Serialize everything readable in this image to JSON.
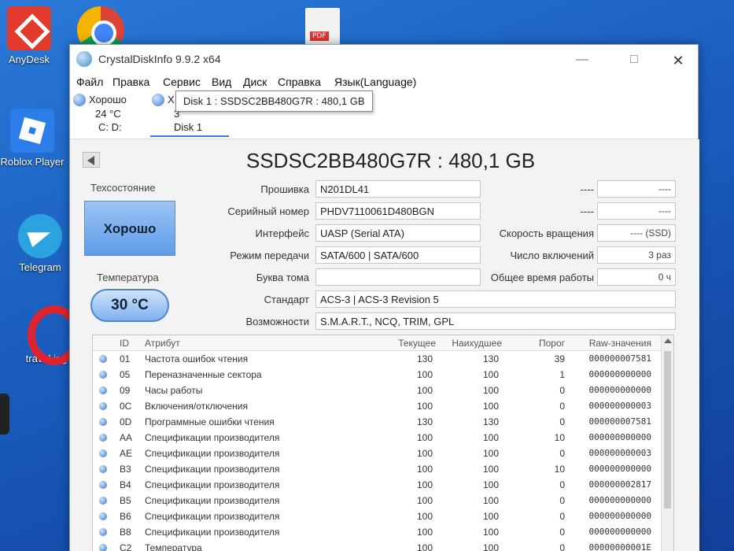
{
  "desktop": {
    "icons": [
      {
        "label": "AnyDesk"
      },
      {
        "label": "Roblox Player"
      },
      {
        "label": "Telegram"
      },
      {
        "label": "travel.jpg"
      }
    ],
    "pdf_badge": "PDF"
  },
  "window": {
    "title": "CrystalDiskInfo 9.9.2 x64",
    "controls": {
      "minimize": "—",
      "maximize": "□",
      "close": "✕"
    }
  },
  "menu": [
    "Файл",
    "Правка",
    "Сервис",
    "Вид",
    "Диск",
    "Справка",
    "Язык(Language)"
  ],
  "disks": [
    {
      "status": "Хорошо",
      "temp": "24 °C",
      "name": "C: D:"
    },
    {
      "status": "Х",
      "temp": "3",
      "name": "Disk 1"
    }
  ],
  "tooltip": "Disk 1 : SSDSC2BB480G7R : 480,1 GB",
  "model_title": "SSDSC2BB480G7R : 480,1 GB",
  "health": {
    "label": "Техсостояние",
    "value": "Хорошо"
  },
  "temperature": {
    "label": "Температура",
    "value": "30 °C"
  },
  "fields": {
    "firmware": {
      "label": "Прошивка",
      "value": "N201DL41"
    },
    "serial": {
      "label": "Серийный номер",
      "value": "PHDV7110061D480BGN"
    },
    "interface": {
      "label": "Интерфейс",
      "value": "UASP (Serial ATA)"
    },
    "transfer": {
      "label": "Режим передачи",
      "value": "SATA/600 | SATA/600"
    },
    "drive_letter": {
      "label": "Буква тома",
      "value": ""
    },
    "standard": {
      "label": "Стандарт",
      "value": "ACS-3 | ACS-3 Revision 5"
    },
    "features": {
      "label": "Возможности",
      "value": "S.M.A.R.T., NCQ, TRIM, GPL"
    }
  },
  "right_fields": {
    "r1": {
      "label": "----",
      "value": "----"
    },
    "r2": {
      "label": "----",
      "value": "----"
    },
    "rotation": {
      "label": "Скорость вращения",
      "value": "---- (SSD)"
    },
    "power_count": {
      "label": "Число включений",
      "value": "3 раз"
    },
    "power_hours": {
      "label": "Общее время работы",
      "value": "0 ч"
    }
  },
  "smart": {
    "headers": {
      "id": "ID",
      "name": "Атрибут",
      "current": "Текущее",
      "worst": "Наихудшее",
      "threshold": "Порог",
      "raw": "Raw-значения"
    },
    "rows": [
      {
        "id": "01",
        "name": "Частота ошибок чтения",
        "current": "130",
        "worst": "130",
        "threshold": "39",
        "raw": "000000007581"
      },
      {
        "id": "05",
        "name": "Переназначенные сектора",
        "current": "100",
        "worst": "100",
        "threshold": "1",
        "raw": "000000000000"
      },
      {
        "id": "09",
        "name": "Часы работы",
        "current": "100",
        "worst": "100",
        "threshold": "0",
        "raw": "000000000000"
      },
      {
        "id": "0C",
        "name": "Включения/отключения",
        "current": "100",
        "worst": "100",
        "threshold": "0",
        "raw": "000000000003"
      },
      {
        "id": "0D",
        "name": "Программные ошибки чтения",
        "current": "130",
        "worst": "130",
        "threshold": "0",
        "raw": "000000007581"
      },
      {
        "id": "AA",
        "name": "Спецификации производителя",
        "current": "100",
        "worst": "100",
        "threshold": "10",
        "raw": "000000000000"
      },
      {
        "id": "AE",
        "name": "Спецификации производителя",
        "current": "100",
        "worst": "100",
        "threshold": "0",
        "raw": "000000000003"
      },
      {
        "id": "B3",
        "name": "Спецификации производителя",
        "current": "100",
        "worst": "100",
        "threshold": "10",
        "raw": "000000000000"
      },
      {
        "id": "B4",
        "name": "Спецификации производителя",
        "current": "100",
        "worst": "100",
        "threshold": "0",
        "raw": "000000002817"
      },
      {
        "id": "B5",
        "name": "Спецификации производителя",
        "current": "100",
        "worst": "100",
        "threshold": "0",
        "raw": "000000000000"
      },
      {
        "id": "B6",
        "name": "Спецификации производителя",
        "current": "100",
        "worst": "100",
        "threshold": "0",
        "raw": "000000000000"
      },
      {
        "id": "B8",
        "name": "Спецификации производителя",
        "current": "100",
        "worst": "100",
        "threshold": "0",
        "raw": "000000000000"
      },
      {
        "id": "C2",
        "name": "Температура",
        "current": "100",
        "worst": "100",
        "threshold": "0",
        "raw": "00000000001E"
      }
    ]
  }
}
